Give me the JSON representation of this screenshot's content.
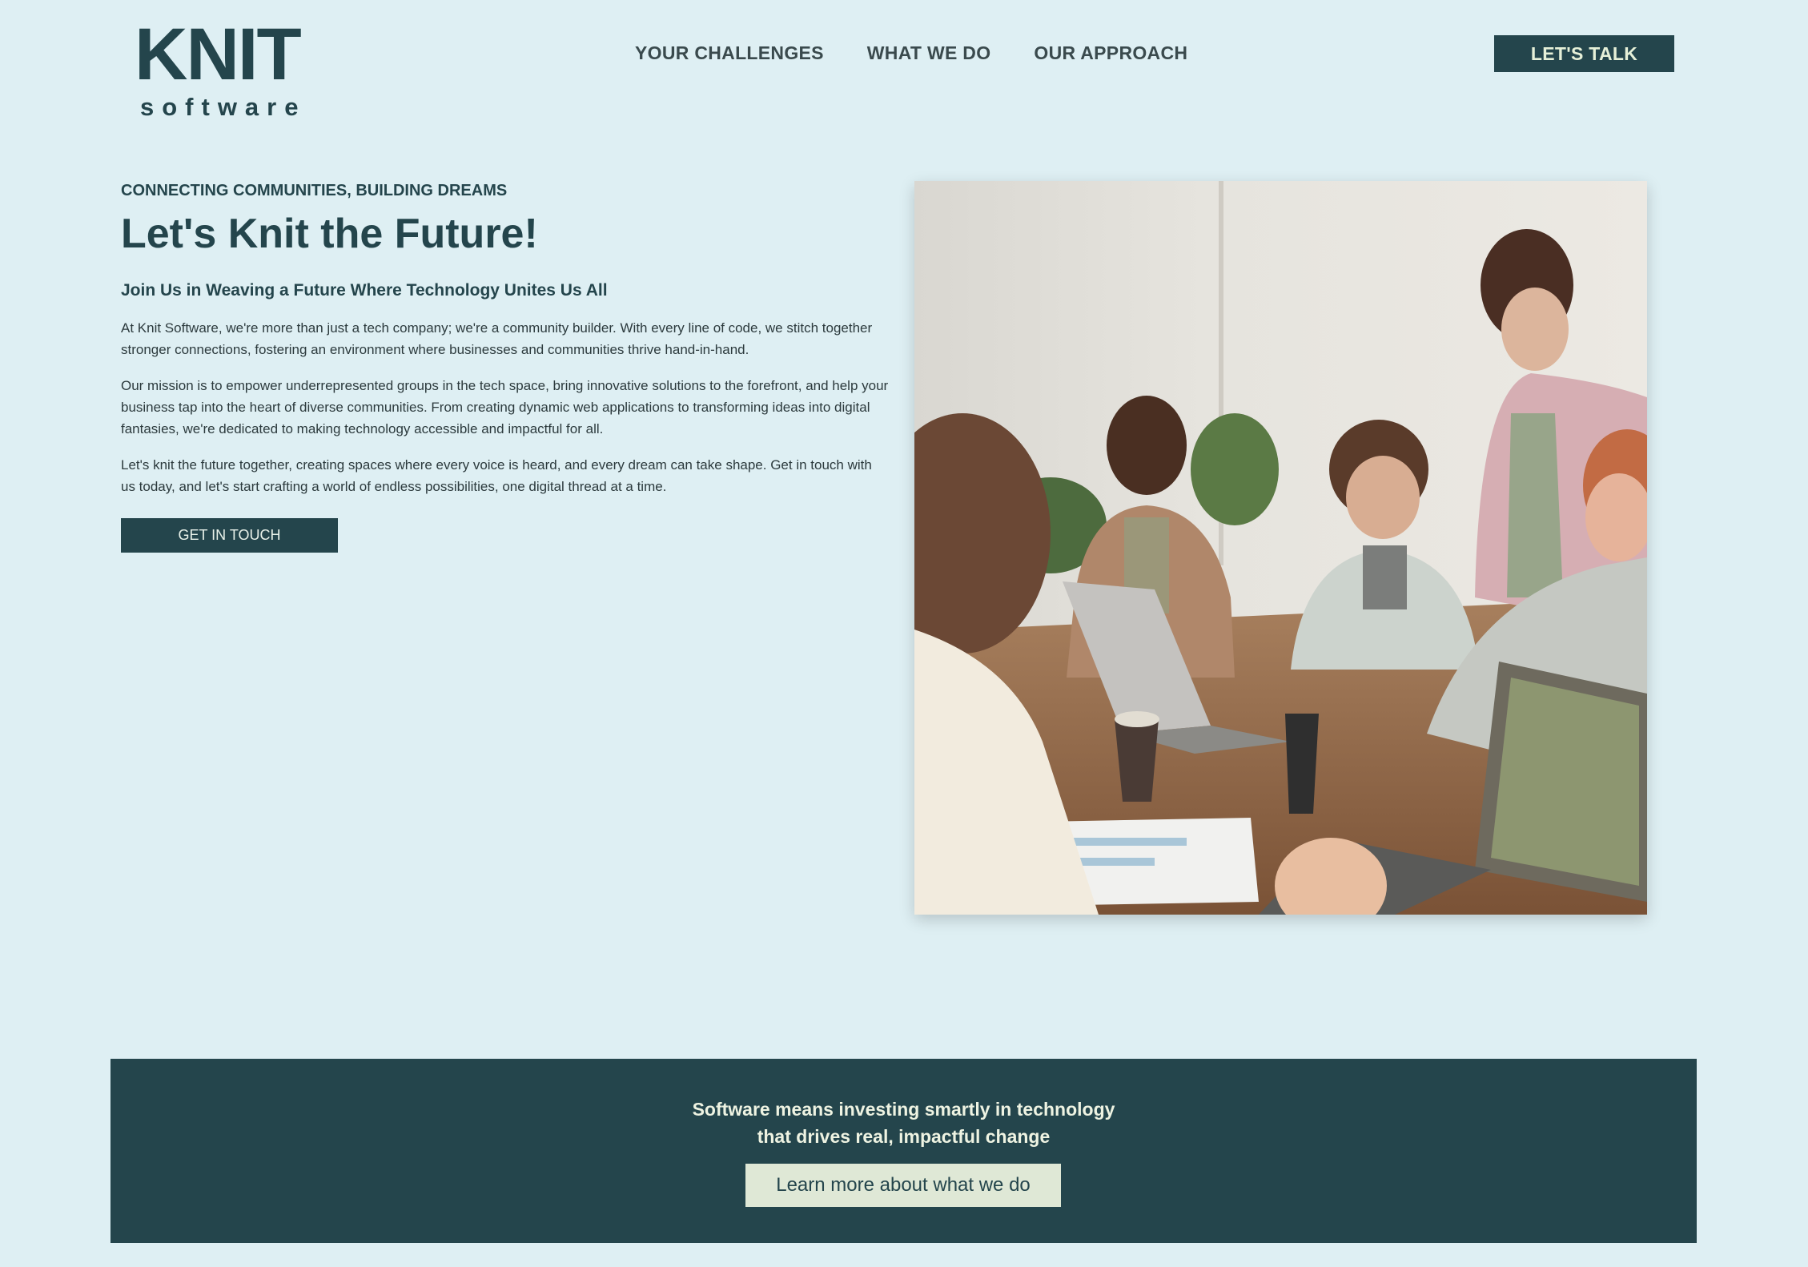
{
  "brand": {
    "logo_main": "KNIT",
    "logo_sub": "software"
  },
  "nav": {
    "items": [
      {
        "label": "YOUR CHALLENGES"
      },
      {
        "label": "WHAT WE DO"
      },
      {
        "label": "OUR APPROACH"
      }
    ],
    "cta_label": "LET'S TALK"
  },
  "hero": {
    "eyebrow": "CONNECTING COMMUNITIES, BUILDING DREAMS",
    "headline": "Let's Knit the Future!",
    "subhead": "Join Us in Weaving a Future Where Technology Unites Us All",
    "paragraphs": [
      "At Knit Software, we're more than just a tech company; we're a community builder. With every line of code, we stitch together stronger connections, fostering an environment where businesses and communities thrive hand-in-hand.",
      "Our mission is to empower underrepresented groups in the tech space, bring innovative solutions to the forefront, and help your business tap into the heart of diverse communities. From creating dynamic web applications to transforming ideas into digital fantasies, we're dedicated to making technology accessible and impactful for all.",
      "Let's knit the future together, creating spaces where every voice is heard, and every dream can take shape. Get in touch with us today, and let's start crafting a world of endless possibilities, one digital thread at a time."
    ],
    "cta_label": "GET IN TOUCH"
  },
  "band": {
    "line1": "Software means investing smartly in technology",
    "line2": "that drives real, impactful change",
    "button_label": "Learn more about what we do"
  },
  "colors": {
    "background": "#deeff3",
    "primary": "#24454c",
    "button_light": "#dfe8d6"
  }
}
